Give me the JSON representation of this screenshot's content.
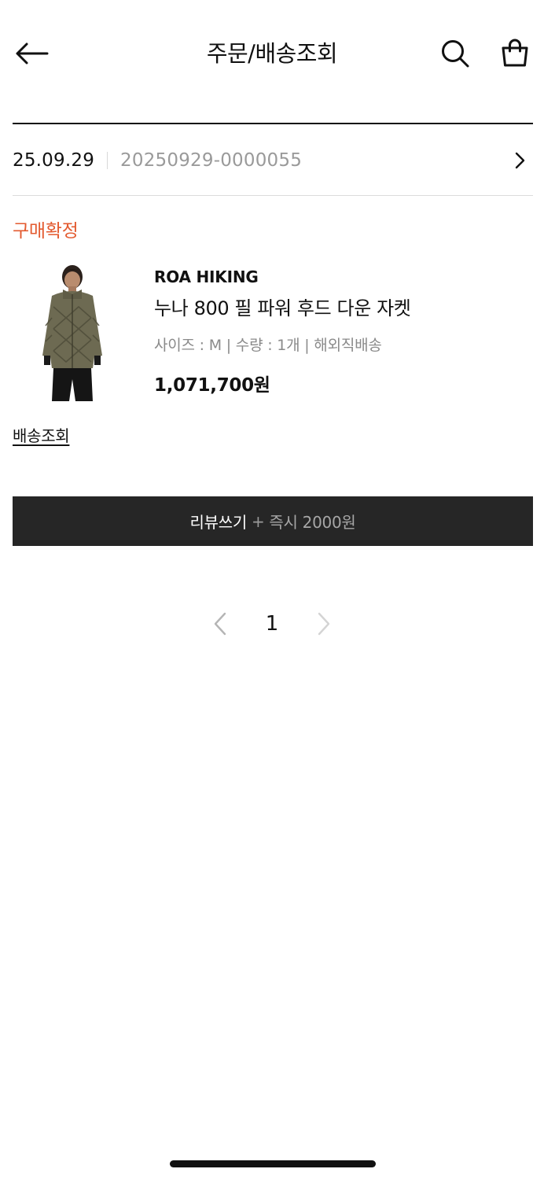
{
  "header": {
    "title": "주문/배송조회",
    "back_icon": "arrow-left-icon",
    "search_icon": "search-icon",
    "cart_icon": "shopping-bag-icon"
  },
  "order": {
    "date": "25.09.29",
    "number": "20250929-0000055",
    "status": "구매확정",
    "status_color": "#e35a2f"
  },
  "product": {
    "brand": "ROA HIKING",
    "name": "누나 800 필 파워 후드 다운 자켓",
    "options": "사이즈 : M | 수량 : 1개 | 해외직배송",
    "price": "1,071,700원",
    "image_icon": "jacket-product-image"
  },
  "tracking_link": "배송조회",
  "review_button": {
    "label": "리뷰쓰기",
    "plus": "+",
    "reward": "즉시 2000원",
    "background": "#262626"
  },
  "pagination": {
    "current": "1"
  }
}
